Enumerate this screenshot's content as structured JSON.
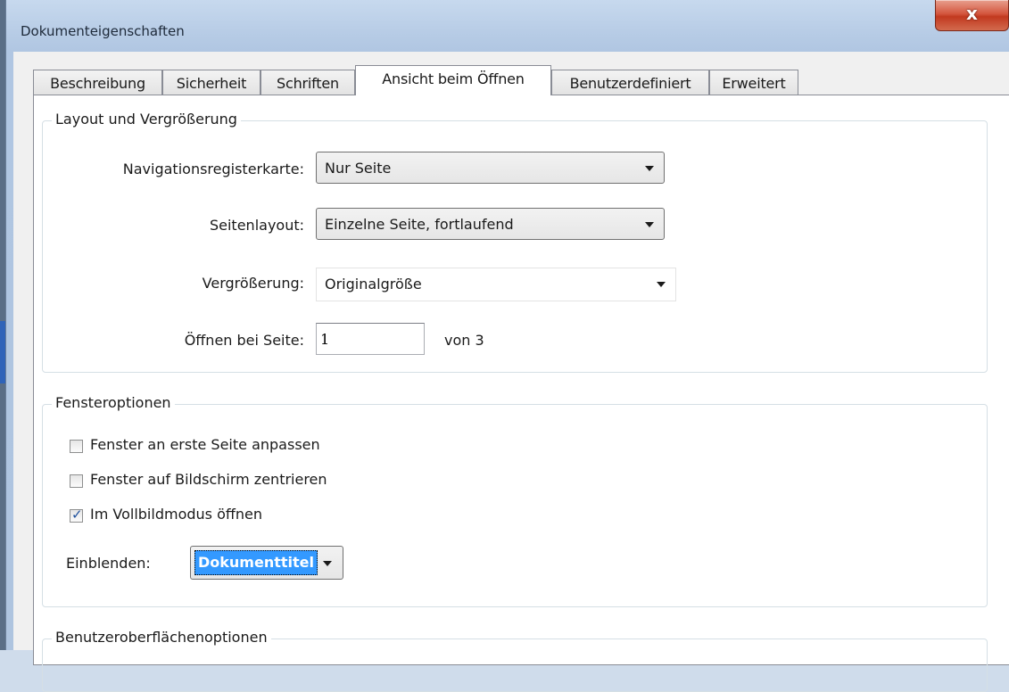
{
  "window": {
    "title": "Dokumenteigenschaften",
    "close_label": "x"
  },
  "tabs": [
    {
      "label": "Beschreibung",
      "active": false
    },
    {
      "label": "Sicherheit",
      "active": false
    },
    {
      "label": "Schriften",
      "active": false
    },
    {
      "label": "Ansicht beim Öffnen",
      "active": true
    },
    {
      "label": "Benutzerdefiniert",
      "active": false
    },
    {
      "label": "Erweitert",
      "active": false
    }
  ],
  "layout_group": {
    "legend": "Layout und Vergrößerung",
    "nav_tab": {
      "label": "Navigationsregisterkarte:",
      "value": "Nur Seite"
    },
    "page_layout": {
      "label": "Seitenlayout:",
      "value": "Einzelne Seite, fortlaufend"
    },
    "magnification": {
      "label": "Vergrößerung:",
      "value": "Originalgröße"
    },
    "open_page": {
      "label": "Öffnen bei Seite:",
      "value": "1",
      "of_text": "von 3"
    }
  },
  "window_options": {
    "legend": "Fensteroptionen",
    "checkboxes": [
      {
        "label": "Fenster an erste Seite anpassen",
        "checked": false
      },
      {
        "label": "Fenster auf Bildschirm zentrieren",
        "checked": false
      },
      {
        "label": "Im Vollbildmodus öffnen",
        "checked": true
      }
    ],
    "show": {
      "label": "Einblenden:",
      "value": "Dokumenttitel"
    }
  },
  "ui_options": {
    "legend": "Benutzeroberflächenoptionen"
  },
  "colors": {
    "selection": "#3399ff",
    "close_button": "#c2391f",
    "titlebar": "#b6cbe5"
  }
}
